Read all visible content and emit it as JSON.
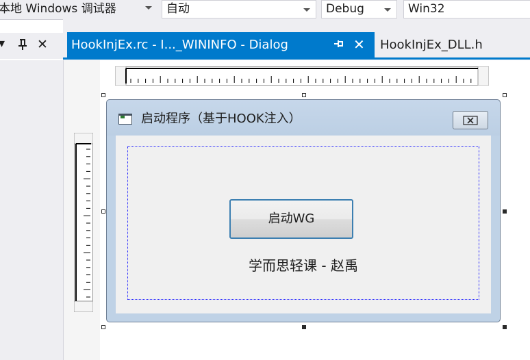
{
  "toolbar": {
    "debugger_label": "本地 Windows 调试器",
    "config_value": "自动",
    "build_config": "Debug",
    "platform": "Win32"
  },
  "left_panel": {
    "dropdown_icon": "▾",
    "pin_icon": "ꟼ",
    "close_icon": "✕"
  },
  "tabs": [
    {
      "label": "HookInjEx.rc - I..._WININFO - Dialog",
      "active": true,
      "pin_glyph": "⊸",
      "close_glyph": "✕"
    },
    {
      "label": "HookInjEx_DLL.h",
      "active": false
    }
  ],
  "dialog": {
    "title": "启动程序（基于HOOK注入）",
    "close_glyph": "⊠",
    "button_label": "启动WG",
    "static_text": "学而思轻课 - 赵禹"
  },
  "colors": {
    "accent": "#007acc",
    "dialog_frame": "#bfd2e6",
    "dotted_border": "#1a1aff"
  }
}
